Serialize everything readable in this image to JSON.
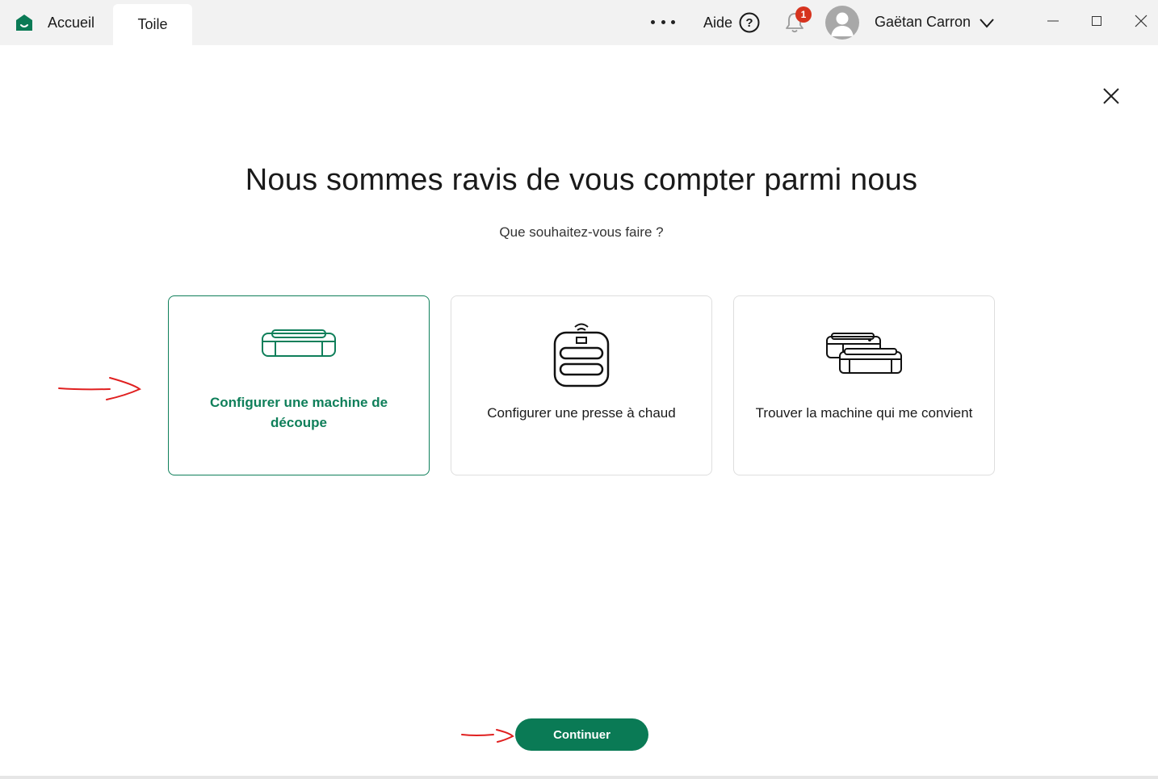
{
  "titlebar": {
    "home_tab": "Accueil",
    "canvas_tab": "Toile",
    "help_label": "Aide",
    "notification_count": "1",
    "user_name": "Gaëtan Carron"
  },
  "dialog": {
    "title": "Nous sommes ravis de vous compter parmi nous",
    "subtitle": "Que souhaitez-vous faire ?",
    "options": [
      {
        "line1": "Configurer une machine de",
        "line2": "découpe",
        "icon": "cutting-machine-icon",
        "selected": true
      },
      {
        "line1": "Configurer une presse à chaud",
        "icon": "heat-press-icon",
        "selected": false
      },
      {
        "line1": "Trouver la machine qui me convient",
        "icon": "machines-icon",
        "selected": false
      }
    ],
    "continue_label": "Continuer"
  },
  "colors": {
    "brand_green": "#0a7a55",
    "selected_text": "#0f7f5a",
    "badge_red": "#d6331e",
    "annotation_red": "#e02020"
  }
}
